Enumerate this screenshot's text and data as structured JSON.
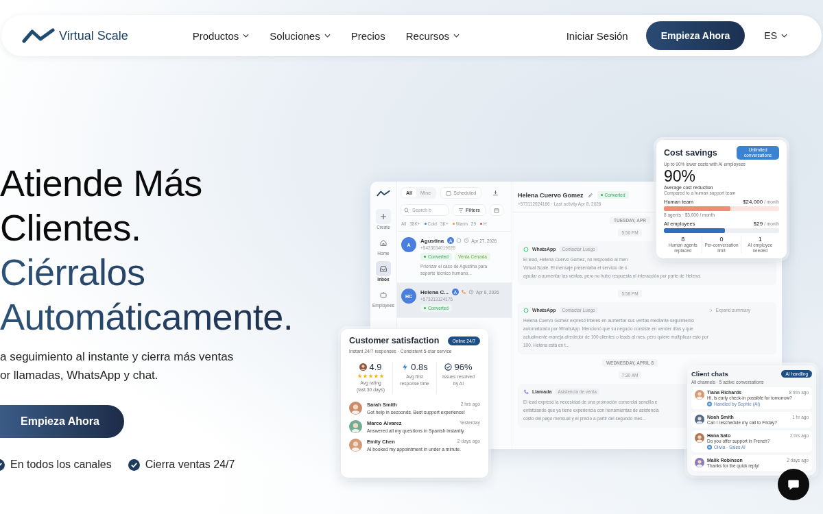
{
  "nav": {
    "logo": "Virtual Scale",
    "links": [
      {
        "label": "Productos",
        "dropdown": true
      },
      {
        "label": "Soluciones",
        "dropdown": true
      },
      {
        "label": "Precios",
        "dropdown": false
      },
      {
        "label": "Recursos",
        "dropdown": true
      }
    ],
    "login": "Iniciar Sesión",
    "cta": "Empieza Ahora",
    "language": "ES"
  },
  "hero": {
    "title_lines": [
      "Atiende Más",
      "Clientes."
    ],
    "accent_lines": [
      "Ciérralos",
      "Automáticamente."
    ],
    "subtitle_lines": [
      "a seguimiento al instante y cierra más ventas",
      "or llamadas, WhatsApp y chat."
    ],
    "cta": "Empieza Ahora",
    "features": [
      "En todos los canales",
      "Cierra ventas 24/7"
    ]
  },
  "app": {
    "sidebar": [
      {
        "label": "Create",
        "selected": false
      },
      {
        "label": "Home",
        "selected": false
      },
      {
        "label": "Inbox",
        "selected": true
      },
      {
        "label": "Employees",
        "selected": false
      }
    ],
    "tabs": [
      {
        "label": "All",
        "selected": true
      },
      {
        "label": "Mine",
        "selected": false
      }
    ],
    "scheduled": "Scheduled",
    "search": {
      "placeholder": "Search b"
    },
    "filters": "Filters",
    "chips": [
      {
        "label": "All",
        "count": "38K+"
      },
      {
        "label": "Cold",
        "count": "3K+",
        "color": "#3b82f6"
      },
      {
        "label": "Warm",
        "count": "29",
        "color": "#f59e0b"
      },
      {
        "label": "H",
        "color": "#ef4444"
      }
    ],
    "leads": [
      {
        "initials": "A",
        "name": "Agustina",
        "badge": "A",
        "kind": "whatsapp",
        "date": "Apr 27, 2026",
        "phone": "+5423634019026",
        "selected": false,
        "tags": [
          {
            "label": "Converted",
            "kind": "status"
          },
          {
            "label": "Venta Cerrada",
            "kind": "plain"
          }
        ],
        "note_lines": [
          "Priorizar el caso de Agustina para",
          "soporte técnico humano..."
        ]
      },
      {
        "initials": "HC",
        "name": "Helena C...",
        "badge": "A",
        "kind": "call",
        "date": "Apr 8, 2026",
        "phone": "+573213124176",
        "selected": true,
        "tags": [
          {
            "label": "Converted",
            "kind": "status"
          }
        ]
      }
    ],
    "detail": {
      "name": "Helena Cuervo Gomez",
      "status": "Converted",
      "meta": "+573112024166 · Last activity Apr 8, 2026",
      "timeline": [
        {
          "kind": "date",
          "text": "TUESDAY, APR"
        },
        {
          "kind": "time",
          "text": "5:56 PM"
        },
        {
          "kind": "whatsapp",
          "title": "WhatsApp",
          "tag": "Contactar Luego",
          "lines": [
            "El lead, Helena Cuervo Gomez, no respondió al men",
            "Virtual Scale. El mensaje presentaba el servicio de s",
            "ayudar a aumentar las ventas, pero no hubo respuesta ni interacción por parte de Helena."
          ]
        },
        {
          "kind": "time",
          "text": "5:58 PM"
        },
        {
          "kind": "whatsapp",
          "title": "WhatsApp",
          "tag": "Contactar Luego",
          "action": "Expand summary",
          "lines": [
            "Helena Cuervo Gomez expresó interés en aumentar sus ventas mediante seguimiento",
            "automatizado por WhatsApp. Mencionó que su negocio consiste en vender rifas y que",
            "actualmente maneja alrededor de 100 clientes o leads al mes, pero quiere multiplicar esto por",
            "100. Helena está en t..."
          ]
        },
        {
          "kind": "date",
          "text": "WEDNESDAY, APRIL 8"
        },
        {
          "kind": "time",
          "text": "7:30 AM"
        },
        {
          "kind": "call",
          "title": "Llamada",
          "tag": "Asistencia de venta",
          "lines": [
            "El lead expresó la necesidad de una promoción comercial sencilla e",
            "enfatizando que ya tiene experiencia con herramientas de asistencia",
            "costo del pago mensual y el precio a partir del segundo mes..."
          ]
        }
      ]
    }
  },
  "cost_savings": {
    "title": "Cost savings",
    "badge": "Unlimited conversations",
    "subtitle": "Up to 90% lower costs with AI employees",
    "headline": "90%",
    "headline_label": "Average cost reduction",
    "headline_note": "Compared to a human support team",
    "rows": [
      {
        "kind": "human",
        "label": "Human team",
        "amount": "$24,000",
        "unit": "/ month",
        "level": 0.58,
        "note": "8 agents · $3,000 / month"
      },
      {
        "kind": "ai",
        "label": "AI employees",
        "amount": "$29",
        "unit": "/ month",
        "level": 0.53
      }
    ],
    "stats": [
      {
        "value": "8",
        "label_lines": [
          "Human agents",
          "replaced"
        ]
      },
      {
        "value": "0",
        "label_lines": [
          "Per-conversation",
          "limit"
        ]
      },
      {
        "value": "1",
        "label_lines": [
          "AI employee",
          "needed"
        ]
      }
    ]
  },
  "satisfaction": {
    "title": "Customer satisfaction",
    "badge": "Online 24/7",
    "subtitle": "Instant 24/7 responses · Consistent 5-star service",
    "stats": [
      {
        "kind": "rating",
        "value": "4.9",
        "stars": 5,
        "label_lines": [
          "Avg rating",
          "(last 30 days)"
        ]
      },
      {
        "kind": "speed",
        "value": "0.8s",
        "label_lines": [
          "Avg first",
          "response time"
        ]
      },
      {
        "kind": "resolved",
        "value": "96%",
        "label_lines": [
          "Issues resolved",
          "by AI"
        ]
      }
    ],
    "reviews": [
      {
        "name": "Sarah Smith",
        "time": "2 hrs ago",
        "text": "Got help in secoonds. Best support experience!"
      },
      {
        "name": "Marco Alvarez",
        "time": "Yesterday",
        "text": "Answered all my questions in Spanish instantly."
      },
      {
        "name": "Emily Chen",
        "time": "2 days ago",
        "text": "AI booked my appointment in under a minute."
      }
    ]
  },
  "client_chats": {
    "title": "Client chats",
    "badge": "AI handling",
    "subtitle": "All channels · 5 active conversations",
    "chats": [
      {
        "name": "Tiana Richards",
        "time": "8 min ago",
        "message": "Hi, is early check-in possible for tomorrow?",
        "handler": "Handled by Sophie (AI)"
      },
      {
        "name": "Noah Smith",
        "time": "1 hr ago",
        "message": "Can I reschedule my call to Friday?"
      },
      {
        "name": "Hana Sato",
        "time": "2 hrs ago",
        "message": "Do you offer support in French?",
        "handler": "Olivia · Sales AI"
      },
      {
        "name": "Malik Robinson",
        "time": "2 days ago",
        "message": "Thanks for the quick reply!"
      }
    ]
  }
}
